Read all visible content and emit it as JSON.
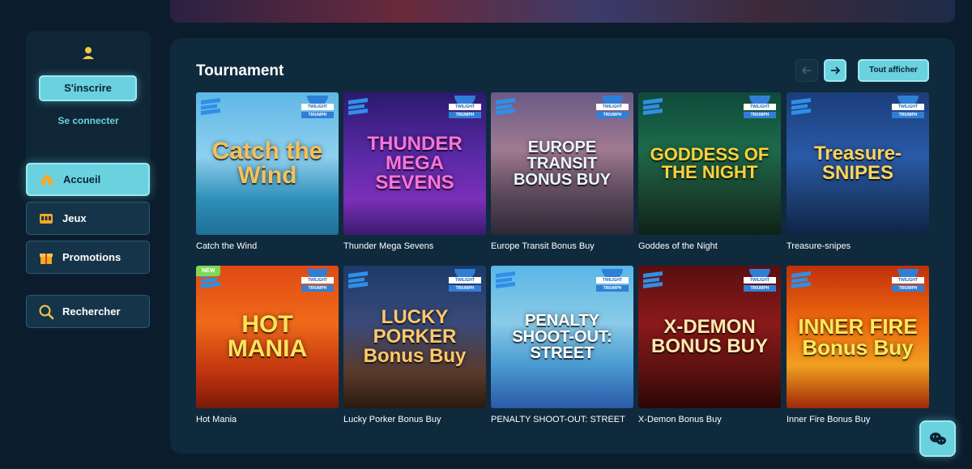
{
  "sidebar": {
    "register_label": "S'inscrire",
    "login_label": "Se connecter",
    "nav": [
      {
        "label": "Accueil",
        "icon": "home-icon",
        "active": true
      },
      {
        "label": "Jeux",
        "icon": "games-icon",
        "active": false
      },
      {
        "label": "Promotions",
        "icon": "gift-icon",
        "active": false
      },
      {
        "label": "Rechercher",
        "icon": "search-icon",
        "active": false
      }
    ]
  },
  "main": {
    "section_title": "Tournament",
    "show_all_label": "Tout afficher",
    "badge_text": {
      "line1": "TWILIGHT",
      "line2": "TRIUMPH",
      "new": "NEW"
    },
    "games": [
      {
        "label": "Catch the Wind",
        "art": "Catch the Wind",
        "bg": "linear-gradient(180deg,#5fb7e6 0%,#8fd0ef 45%,#2f8fb8 75%,#1f6f95 100%)",
        "fg": "#f5c15a",
        "size": 30,
        "new": false
      },
      {
        "label": "Thunder Mega Sevens",
        "art": "THUNDER MEGA SEVENS",
        "bg": "linear-gradient(180deg,#2a1a6e 0%,#5a2aa6 45%,#7b2fb8 75%,#3a1b6e 100%)",
        "fg": "#ff73d9",
        "size": 24,
        "new": false
      },
      {
        "label": "Europe Transit Bonus Buy",
        "art": "EUROPE TRANSIT BONUS BUY",
        "bg": "linear-gradient(180deg,#6a5a86 0%,#a07a92 40%,#5e4a5e 70%,#2d2836 100%)",
        "fg": "#eaf4ff",
        "size": 20,
        "new": false
      },
      {
        "label": "Goddes of the Night",
        "art": "GODDESS OF THE NIGHT",
        "bg": "linear-gradient(180deg,#0f4a3a 0%,#1d6a4a 40%,#1a3f2c 75%,#0d2218 100%)",
        "fg": "#ffd23a",
        "size": 22,
        "new": false
      },
      {
        "label": "Treasure-snipes",
        "art": "Treasure-SNIPES",
        "bg": "linear-gradient(180deg,#1b3d7a 0%,#2a5aa8 45%,#1c3d6e 75%,#0f2446 100%)",
        "fg": "#ffd35a",
        "size": 24,
        "new": false
      },
      {
        "label": "Hot Mania",
        "art": "HOT MANIA",
        "bg": "linear-gradient(180deg,#e04a14 0%,#f06a1a 40%,#c0340e 75%,#7a1a08 100%)",
        "fg": "#ffe35a",
        "size": 30,
        "new": true
      },
      {
        "label": "Lucky Porker Bonus Buy",
        "art": "LUCKY PORKER Bonus Buy",
        "bg": "linear-gradient(180deg,#1c3a6a 0%,#3a4a7a 40%,#5a3a2a 75%,#2a1a10 100%)",
        "fg": "#ffc86a",
        "size": 24,
        "new": false
      },
      {
        "label": "PENALTY SHOOT-OUT: STREET",
        "art": "PENALTY SHOOT-OUT: STREET",
        "bg": "linear-gradient(180deg,#5ab6e6 0%,#8acbe8 40%,#4a9ad0 70%,#2a5aa8 100%)",
        "fg": "#ffffff",
        "size": 20,
        "new": false
      },
      {
        "label": "X-Demon Bonus Buy",
        "art": "X-DEMON BONUS BUY",
        "bg": "linear-gradient(180deg,#5a0e10 0%,#8a1a1a 40%,#5a1010 75%,#2a0606 100%)",
        "fg": "#ffe8b0",
        "size": 24,
        "new": false
      },
      {
        "label": "Inner Fire Bonus Buy",
        "art": "INNER FIRE Bonus Buy",
        "bg": "linear-gradient(180deg,#c0300a 0%,#f06a10 40%,#f0a020 70%,#a02808 100%)",
        "fg": "#ffe85a",
        "size": 26,
        "new": false
      }
    ]
  },
  "colors": {
    "accent": "#6ad1df",
    "background": "#0b1d2c",
    "panel": "#0f2a3d"
  }
}
